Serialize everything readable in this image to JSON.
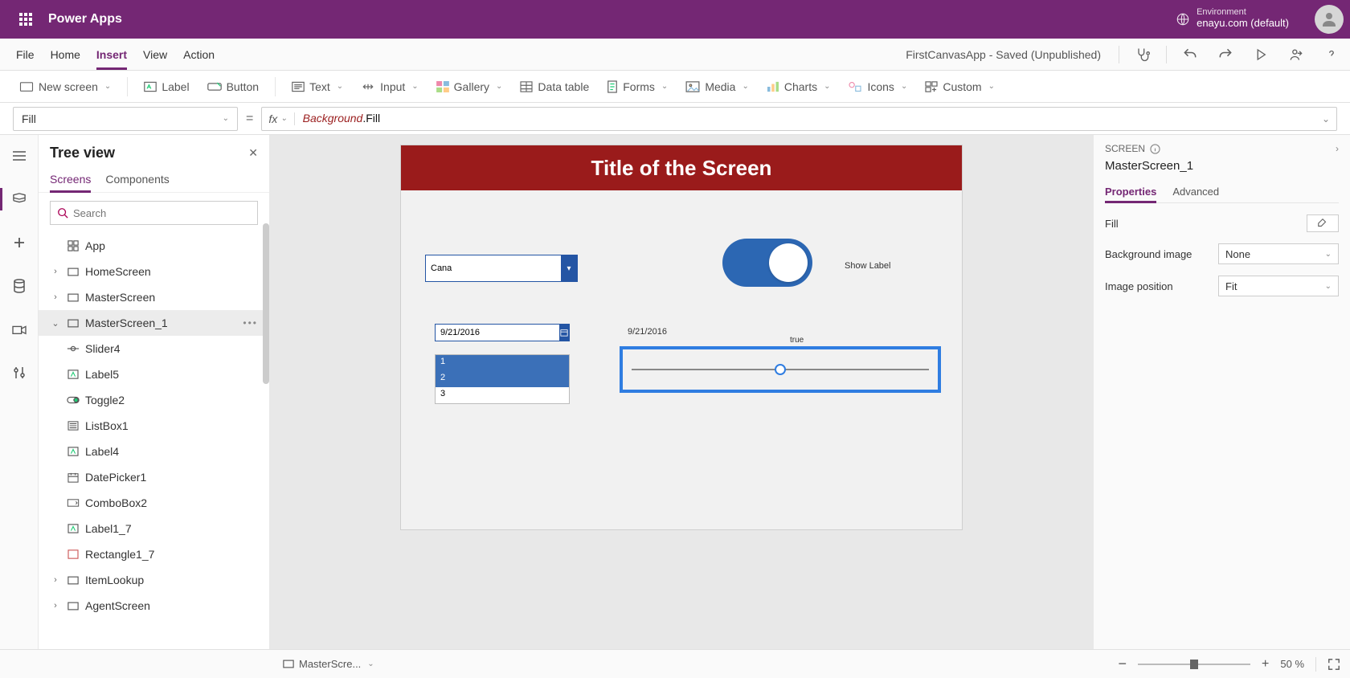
{
  "header": {
    "brand": "Power Apps",
    "env_label": "Environment",
    "env_name": "enayu.com (default)"
  },
  "menu": {
    "items": [
      "File",
      "Home",
      "Insert",
      "View",
      "Action"
    ],
    "active": "Insert",
    "saved": "FirstCanvasApp - Saved (Unpublished)"
  },
  "ribbon": {
    "new_screen": "New screen",
    "label": "Label",
    "button": "Button",
    "text": "Text",
    "input": "Input",
    "gallery": "Gallery",
    "data_table": "Data table",
    "forms": "Forms",
    "media": "Media",
    "charts": "Charts",
    "icons": "Icons",
    "custom": "Custom"
  },
  "formula": {
    "property": "Fill",
    "fx": "fx",
    "expr_ident": "Background",
    "expr_prop": ".Fill"
  },
  "tree": {
    "title": "Tree view",
    "tabs": {
      "screens": "Screens",
      "components": "Components"
    },
    "search_placeholder": "Search",
    "app": "App",
    "items": {
      "home": "HomeScreen",
      "master": "MasterScreen",
      "master1": "MasterScreen_1",
      "slider4": "Slider4",
      "label5": "Label5",
      "toggle2": "Toggle2",
      "listbox1": "ListBox1",
      "label4": "Label4",
      "datepicker1": "DatePicker1",
      "combobox2": "ComboBox2",
      "label1_7": "Label1_7",
      "rectangle1_7": "Rectangle1_7",
      "itemlookup": "ItemLookup",
      "agentscreen": "AgentScreen"
    }
  },
  "canvas": {
    "title": "Title of the Screen",
    "combo_value": "Cana",
    "show_label": "Show Label",
    "date_value": "9/21/2016",
    "date_label": "9/21/2016",
    "true_label": "true",
    "list": [
      "1",
      "2",
      "3"
    ]
  },
  "props": {
    "head": "SCREEN",
    "name": "MasterScreen_1",
    "tabs": {
      "properties": "Properties",
      "advanced": "Advanced"
    },
    "fill": "Fill",
    "bg_image": "Background image",
    "bg_image_value": "None",
    "img_pos": "Image position",
    "img_pos_value": "Fit"
  },
  "status": {
    "screen_name": "MasterScre...",
    "zoom": "50",
    "zoom_pct": "%"
  }
}
